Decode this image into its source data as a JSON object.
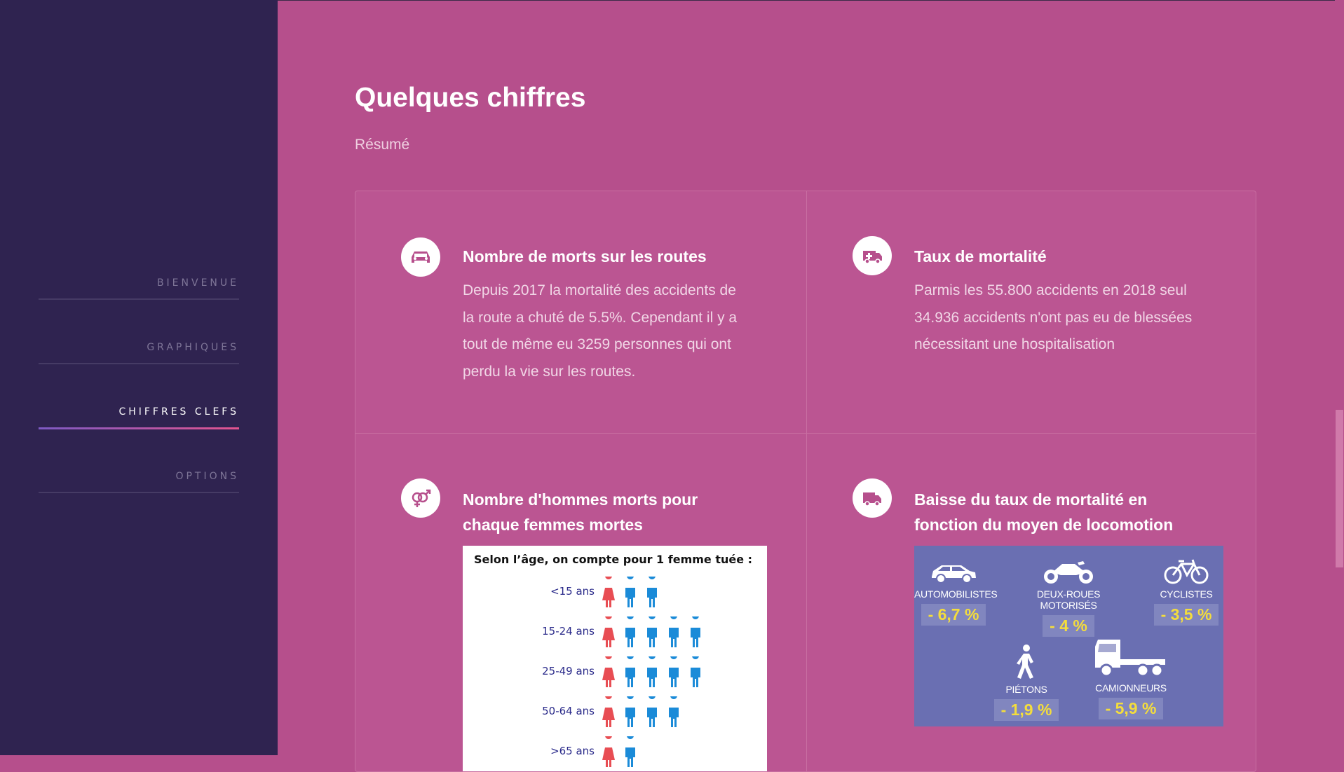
{
  "nav": {
    "items": [
      {
        "label": "BIENVENUE",
        "active": false
      },
      {
        "label": "GRAPHIQUES",
        "active": false
      },
      {
        "label": "CHIFFRES CLEFS",
        "active": true
      },
      {
        "label": "OPTIONS",
        "active": false
      }
    ]
  },
  "page": {
    "title": "Quelques chiffres",
    "subtitle": "Résumé"
  },
  "cards": [
    {
      "icon": "car-icon",
      "title": "Nombre de morts sur les routes",
      "lines": [
        "Depuis 2017 la mortalité des accidents de",
        "la route a chuté de 5.5%. Cependant il y a",
        "tout de même eu 3259 personnes qui ont",
        "perdu la vie sur les routes."
      ]
    },
    {
      "icon": "ambulance-icon",
      "title": "Taux de mortalité",
      "lines": [
        "Parmis les 55.800 accidents en 2018 seul",
        "34.936 accidents n'ont pas eu de blessées",
        "nécessitant une hospitalisation"
      ]
    },
    {
      "icon": "gender-icon",
      "title_lines": [
        "Nombre d'hommes morts pour",
        "chaque femmes mortes"
      ]
    },
    {
      "icon": "truck-icon",
      "title_lines": [
        "Baisse du taux de mortalité en",
        "fonction du moyen de locomotion"
      ]
    }
  ],
  "age_infographic": {
    "heading": "Selon l’âge, on compte pour 1 femme tuée :",
    "rows": [
      {
        "label": "<15 ans",
        "women": 1,
        "men": 2
      },
      {
        "label": "15-24 ans",
        "women": 1,
        "men": 4
      },
      {
        "label": "25-49 ans",
        "women": 1,
        "men": 4.3
      },
      {
        "label": "50-64 ans",
        "women": 1,
        "men": 3
      },
      {
        "label": ">65 ans",
        "women": 1,
        "men": 1.3
      }
    ],
    "colors": {
      "women": "#e84d53",
      "men": "#1b8bd8"
    }
  },
  "transport_infographic": {
    "items": [
      {
        "icon": "car-icon",
        "label": "AUTOMOBILISTES",
        "value": "- 6,7 %"
      },
      {
        "icon": "motorcycle-icon",
        "label": "DEUX-ROUES MOTORISÉS",
        "value": "- 4 %"
      },
      {
        "icon": "bicycle-icon",
        "label": "CYCLISTES",
        "value": "- 3,5 %"
      },
      {
        "icon": "pedestrian-icon",
        "label": "PIÉTONS",
        "value": "- 1,9 %"
      },
      {
        "icon": "truck-icon",
        "label": "CAMIONNEURS",
        "value": "- 5,9 %"
      }
    ],
    "colors": {
      "background": "#6a6fb2",
      "value": "#f4dd3c"
    }
  },
  "colors": {
    "sidebar": "#2f2350",
    "main": "#b64f8c",
    "accent_start": "#7e5ac4",
    "accent_end": "#e2548f"
  }
}
